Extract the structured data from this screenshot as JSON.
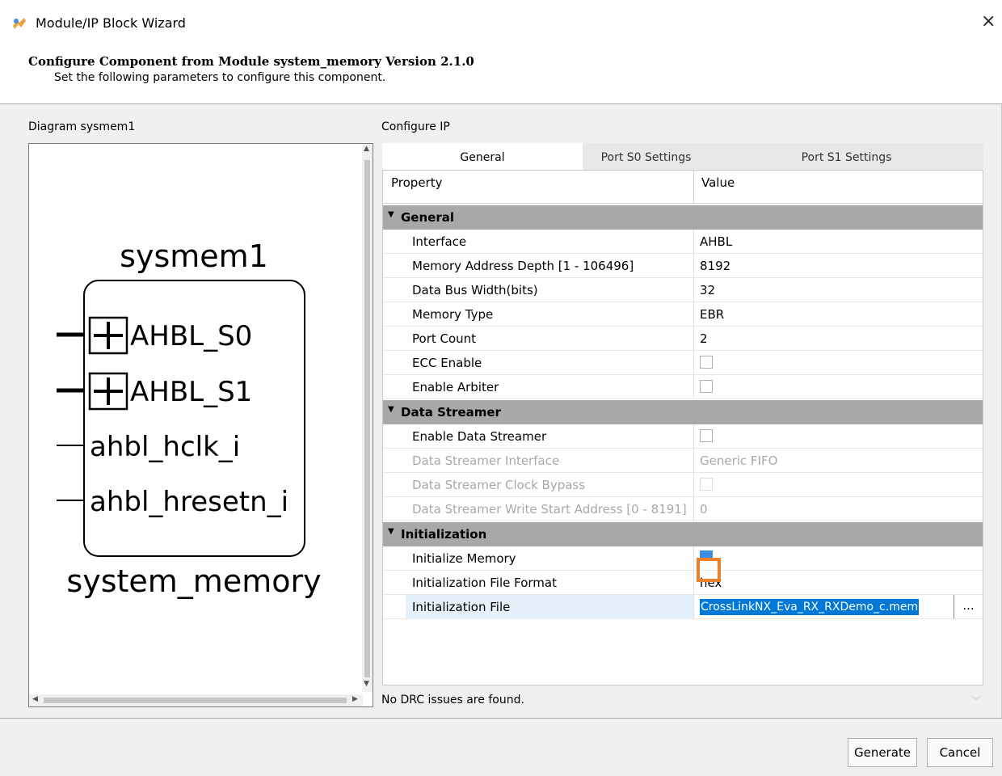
{
  "window": {
    "title": "Module/IP Block Wizard",
    "close_glyph": "×"
  },
  "header": {
    "title": "Configure Component from Module system_memory Version 2.1.0",
    "subtitle": "Set the following parameters to configure this component."
  },
  "diagram": {
    "label": "Diagram sysmem1",
    "instance_name": "sysmem1",
    "module_name": "system_memory",
    "ports": [
      "AHBL_S0",
      "AHBL_S1",
      "ahbl_hclk_i",
      "ahbl_hresetn_i"
    ]
  },
  "configure": {
    "label": "Configure IP",
    "tabs": [
      "General",
      "Port S0 Settings",
      "Port S1 Settings"
    ],
    "active_tab": "General",
    "columns": {
      "property": "Property",
      "value": "Value"
    },
    "sections": [
      {
        "name": "General",
        "rows": [
          {
            "property": "Interface",
            "value": "AHBL"
          },
          {
            "property": "Memory Address Depth  [1 - 106496]",
            "value": "8192"
          },
          {
            "property": "Data Bus Width(bits)",
            "value": "32"
          },
          {
            "property": "Memory Type",
            "value": "EBR"
          },
          {
            "property": "Port Count",
            "value": "2"
          },
          {
            "property": "ECC Enable",
            "checked": false
          },
          {
            "property": "Enable Arbiter",
            "checked": false
          }
        ]
      },
      {
        "name": "Data Streamer",
        "rows": [
          {
            "property": "Enable Data Streamer",
            "checked": false
          },
          {
            "property": "Data Streamer Interface",
            "value": "Generic FIFO",
            "disabled": true
          },
          {
            "property": "Data Streamer Clock Bypass",
            "checked": false,
            "disabled": true
          },
          {
            "property": "Data Streamer Write Start Address  [0 - 8191]",
            "value": "0",
            "disabled": true
          }
        ]
      },
      {
        "name": "Initialization",
        "rows": [
          {
            "property": "Initialize Memory",
            "checked": true
          },
          {
            "property": "Initialization File Format",
            "value": "hex"
          },
          {
            "property": "Initialization File",
            "value": "CrossLinkNX_Eva_RX_RXDemo_c.mem",
            "browse": "..."
          }
        ]
      }
    ]
  },
  "status": {
    "text": "No DRC issues are found."
  },
  "buttons": {
    "generate": "Generate",
    "cancel": "Cancel"
  },
  "colors": {
    "section_bg": "#a8a8a8",
    "highlight": "#0078d7",
    "callout": "#ee7f2d"
  }
}
